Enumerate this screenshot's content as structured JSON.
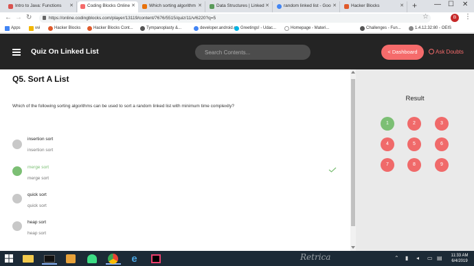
{
  "browser": {
    "tabs": [
      {
        "title": "Intro to Java: Functions",
        "active": false
      },
      {
        "title": "Coding Blocks Online",
        "active": true
      },
      {
        "title": "Which sorting algorithm",
        "active": false
      },
      {
        "title": "Data Structures | Linked",
        "active": false
      },
      {
        "title": "random linked list - Goo",
        "active": false
      },
      {
        "title": "Hacker Blocks",
        "active": false
      }
    ],
    "url": "https://online.codingblocks.com/player/13119/content/7676/5515/quiz/11/v/6220?q=5",
    "bookmarks": [
      "Apps",
      "vvi",
      "Hacker Blocks",
      "Hacker Blocks Cont...",
      "Tympanoplasty &...",
      "developer.android.c...",
      "Greetings! - Udac...",
      "Homepage - Materi...",
      "Challenges - Fun...",
      "1.4.12.32:80 - OEIS"
    ],
    "profile_initial": "B"
  },
  "header": {
    "title": "Quiz On Linked List",
    "search_placeholder": "Search Contents...",
    "dashboard_label": "< Dashboard",
    "ask_doubts_label": "Ask Doubts"
  },
  "question": {
    "title": "Q5. Sort A List",
    "text": "Which of the following sorting algorithms can be used to sort a random linked list with minimum time complexity?",
    "options": [
      {
        "label": "insertion sort",
        "sub": "insertion sort",
        "correct": false
      },
      {
        "label": "merge sort",
        "sub": "merge sort",
        "correct": true
      },
      {
        "label": "quick sort",
        "sub": "quick sort",
        "correct": false
      },
      {
        "label": "heap sort",
        "sub": "heap sort",
        "correct": false
      }
    ]
  },
  "result": {
    "title": "Result",
    "questions": [
      {
        "n": "1",
        "status": "done"
      },
      {
        "n": "2",
        "status": "pending"
      },
      {
        "n": "3",
        "status": "pending"
      },
      {
        "n": "4",
        "status": "pending"
      },
      {
        "n": "5",
        "status": "pending"
      },
      {
        "n": "6",
        "status": "pending"
      },
      {
        "n": "7",
        "status": "pending"
      },
      {
        "n": "8",
        "status": "pending"
      },
      {
        "n": "9",
        "status": "pending"
      }
    ]
  },
  "taskbar": {
    "watermark": "Retrica",
    "time": "11:33 AM",
    "date": "6/4/2019"
  },
  "colors": {
    "accent": "#f56b6b",
    "correct": "#7cbf74",
    "header_bg": "#242424"
  }
}
